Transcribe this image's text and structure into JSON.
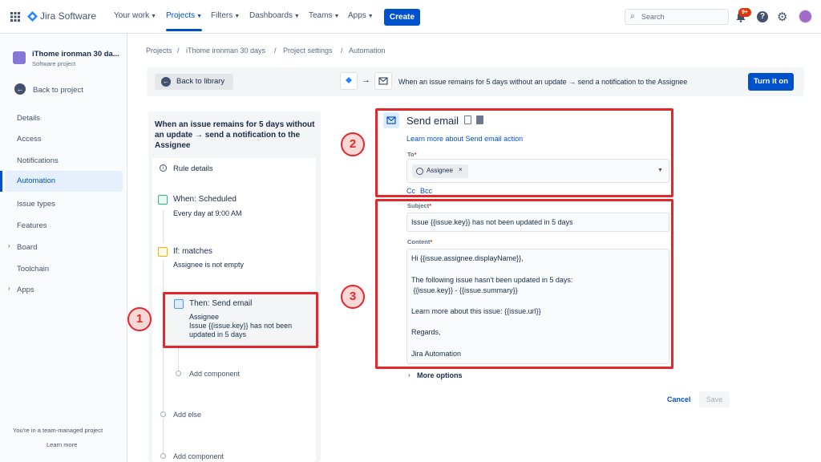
{
  "nav": {
    "product": "Jira Software",
    "items": [
      "Your work",
      "Projects",
      "Filters",
      "Dashboards",
      "Teams",
      "Apps"
    ],
    "create": "Create",
    "search_placeholder": "Search",
    "notif_badge": "9+"
  },
  "sidebar": {
    "project_name": "iThome ironman 30 da...",
    "project_type": "Software project",
    "back": "Back to project",
    "items": [
      "Details",
      "Access",
      "Notifications",
      "Automation",
      "Issue types",
      "Features",
      "Board",
      "Toolchain",
      "Apps"
    ],
    "footer": "You're in a team-managed project",
    "learn_more": "Learn more"
  },
  "breadcrumb": [
    "Projects",
    "iThome ironman 30 days",
    "Project settings",
    "Automation"
  ],
  "banner": {
    "back_library": "Back to library",
    "description": "When an issue remains for 5 days without an update → send a notification to the Assignee",
    "turn_on": "Turn it on"
  },
  "rule": {
    "title": "When an issue remains for 5 days without an update → send a notification to the Assignee",
    "details": "Rule details",
    "when_title": "When: Scheduled",
    "when_sub": "Every day at 9:00 AM",
    "if_title": "If: matches",
    "if_sub": "Assignee is not empty",
    "then_title": "Then: Send email",
    "then_sub1": "Assignee",
    "then_sub2": "Issue {{issue.key}} has not been",
    "then_sub3": "updated in 5 days",
    "add_component": "Add component",
    "add_else": "Add else"
  },
  "email": {
    "title": "Send email",
    "learn_more": "Learn more about Send email action",
    "to_label": "To",
    "to_value": "Assignee",
    "cc": "Cc",
    "bcc": "Bcc",
    "subject_label": "Subject",
    "subject_value": "Issue {{issue.key}} has not been updated in 5 days",
    "content_label": "Content",
    "content_lines": [
      "Hi {{issue.assignee.displayName}},",
      "The following issue hasn't been updated in 5 days:",
      " {{issue.key}} - {{issue.summary}}",
      "Learn more about this issue: {{issue.url}}",
      "Regards,",
      "Jira Automation"
    ],
    "more_options": "More options",
    "cancel": "Cancel",
    "save": "Save"
  },
  "annotations": [
    "1",
    "2",
    "3"
  ],
  "colors": {
    "brand": "#0052cc",
    "annotation": "#e5262b"
  }
}
